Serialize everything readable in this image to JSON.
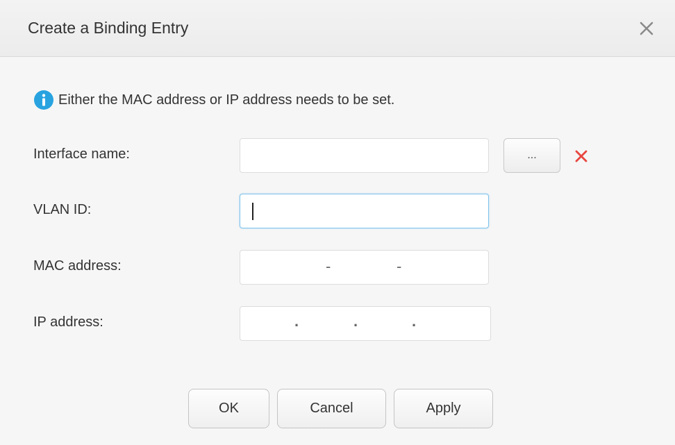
{
  "dialog": {
    "title": "Create a Binding Entry",
    "info_message": "Either the MAC address or IP address needs to be set."
  },
  "fields": {
    "interface_name": {
      "label": "Interface name:",
      "value": ""
    },
    "vlan_id": {
      "label": "VLAN ID:",
      "value": ""
    },
    "mac_address": {
      "label": "MAC address:",
      "separators": [
        "-",
        "-"
      ]
    },
    "ip_address": {
      "label": "IP address:",
      "separators": [
        ".",
        ".",
        "."
      ]
    }
  },
  "buttons": {
    "browse": "...",
    "ok": "OK",
    "cancel": "Cancel",
    "apply": "Apply"
  },
  "icons": {
    "close": "close-icon",
    "info": "info-icon",
    "clear": "clear-icon"
  },
  "colors": {
    "info_blue": "#29a3e0",
    "clear_red": "#e8463f",
    "focus_border": "#7fc3ec"
  }
}
